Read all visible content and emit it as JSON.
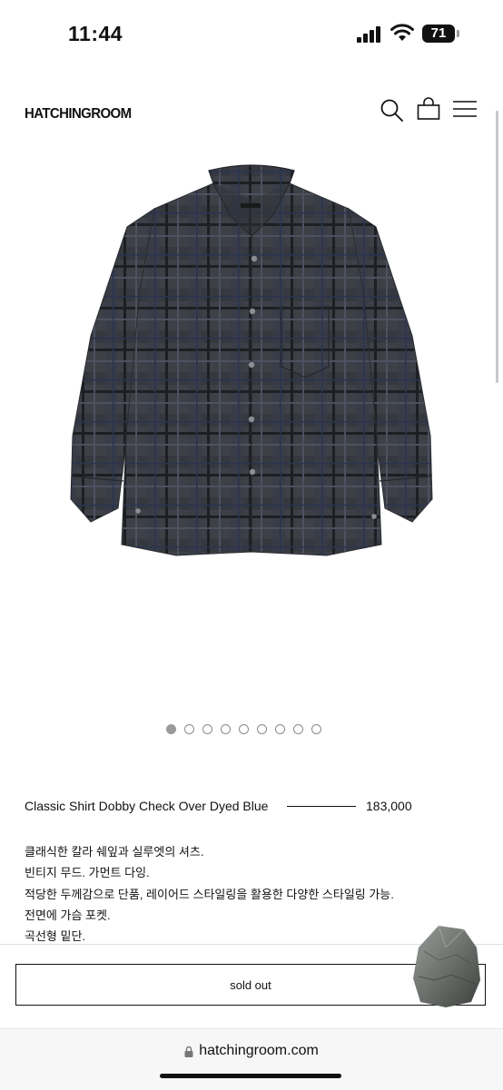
{
  "status_bar": {
    "time": "11:44",
    "battery": "71"
  },
  "header": {
    "logo": "HATCHINGROOM",
    "icons": [
      "search-icon",
      "bag-icon",
      "menu-icon"
    ]
  },
  "gallery": {
    "image_count": 9,
    "active_index": 0
  },
  "product": {
    "title": "Classic Shirt Dobby Check Over Dyed Blue",
    "price": "183,000",
    "description": [
      "클래식한 칼라 쉐잎과 실루엣의 셔츠.",
      "빈티지 무드. 가먼트 다잉.",
      "적당한 두께감으로 단품, 레이어드 스타일링을 활용한 다양한 스타일링 가능.",
      "전면에 가슴 포켓.",
      "곡선형 밑단."
    ]
  },
  "cta": {
    "label": "sold out"
  },
  "browser": {
    "url": "hatchingroom.com"
  }
}
